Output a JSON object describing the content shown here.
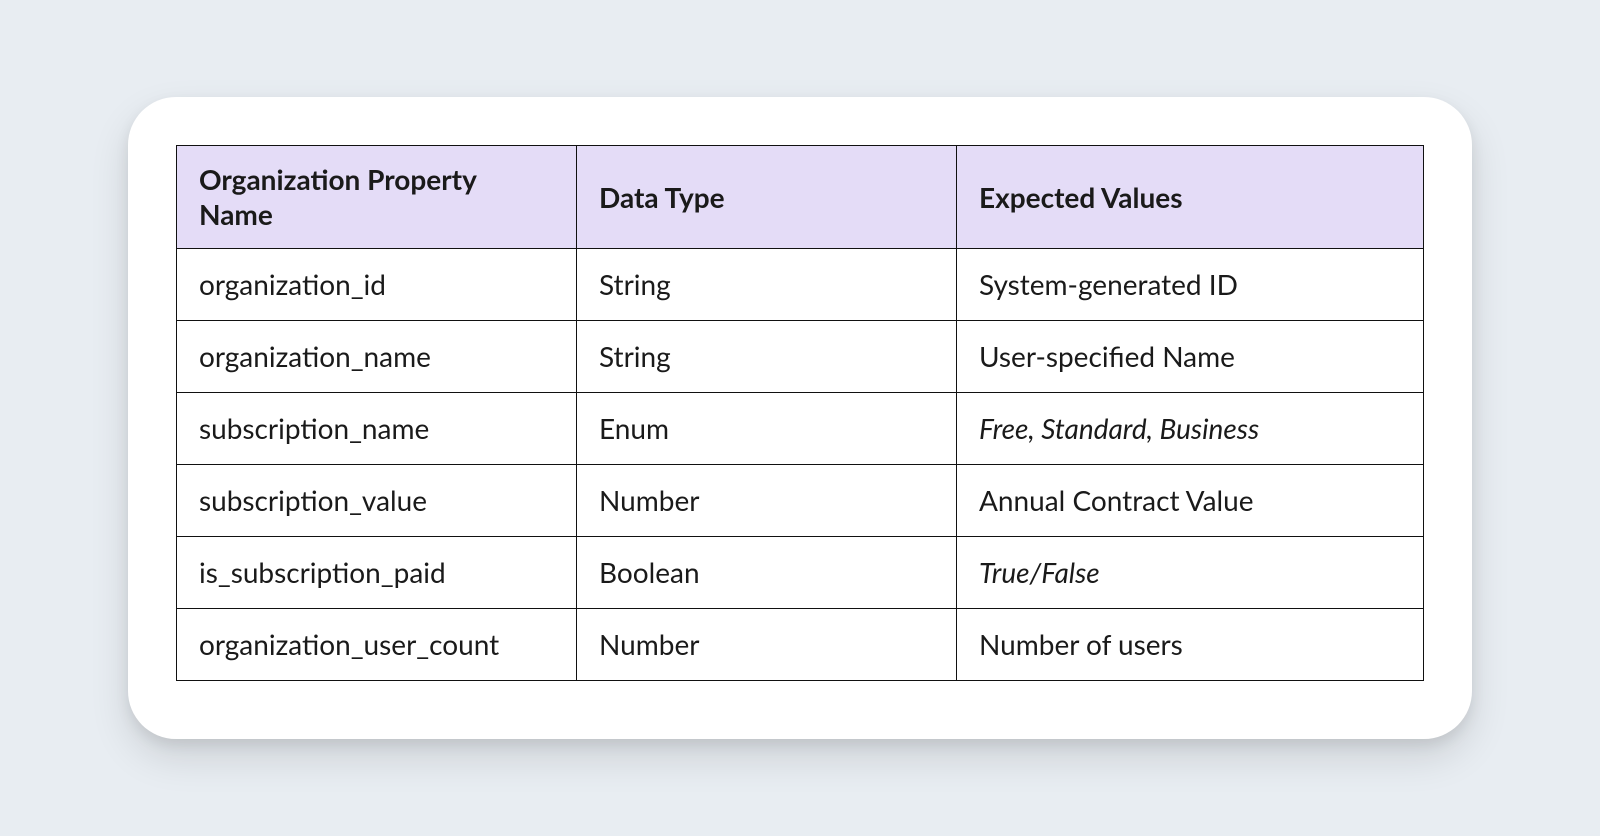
{
  "chart_data": {
    "type": "table",
    "headers": [
      "Organization Property Name",
      "Data Type",
      "Expected Values"
    ],
    "rows": [
      {
        "property": "organization_id",
        "type": "String",
        "expected": "System-generated ID",
        "italic": false
      },
      {
        "property": "organization_name",
        "type": "String",
        "expected": "User-specified Name",
        "italic": false
      },
      {
        "property": "subscription_name",
        "type": "Enum",
        "expected": "Free, Standard, Business",
        "italic": true
      },
      {
        "property": "subscription_value",
        "type": "Number",
        "expected": "Annual Contract Value",
        "italic": false
      },
      {
        "property": "is_subscription_paid",
        "type": "Boolean",
        "expected": "True/False",
        "italic": true
      },
      {
        "property": "organization_user_count",
        "type": "Number",
        "expected": "Number of users",
        "italic": false
      }
    ]
  }
}
